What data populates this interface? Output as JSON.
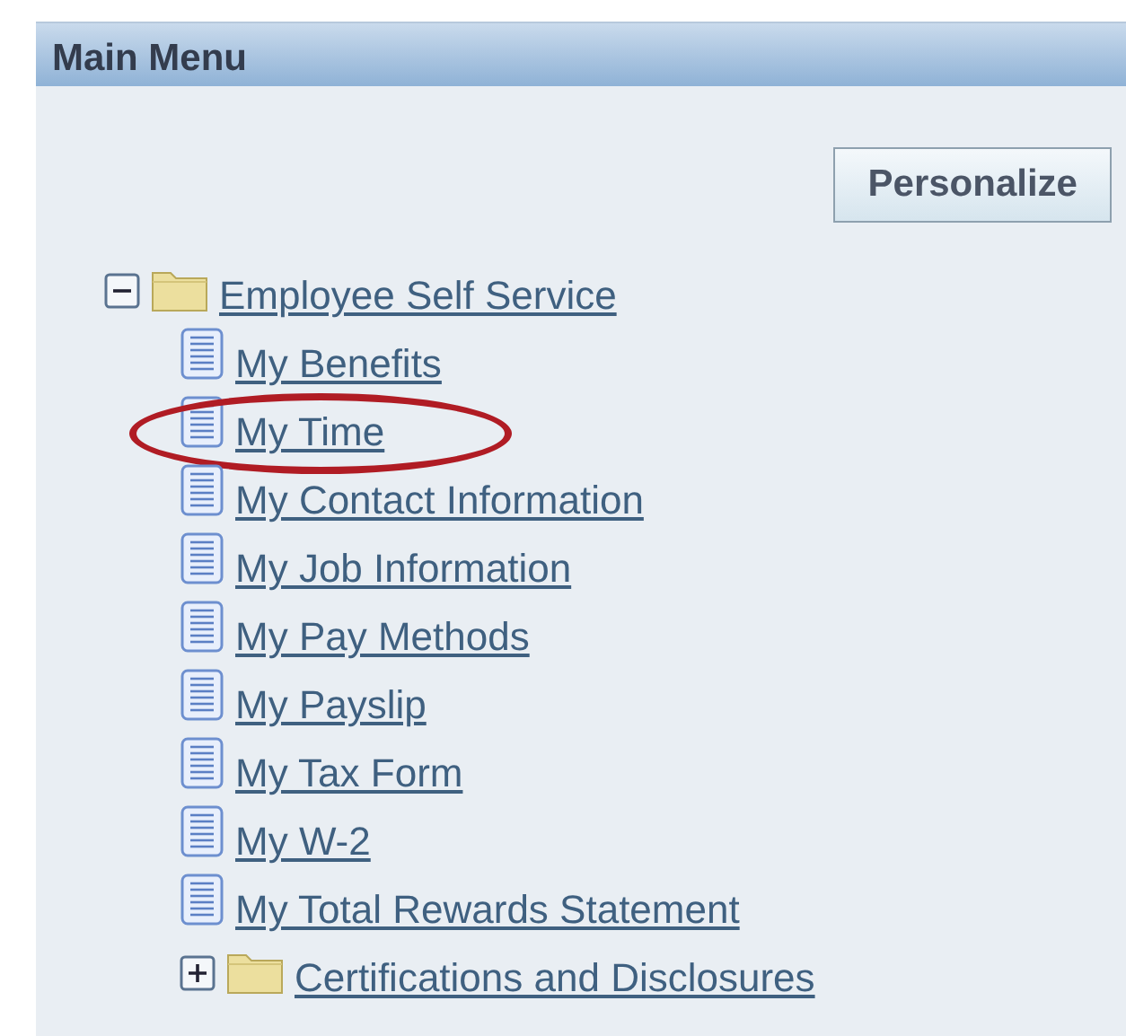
{
  "panel": {
    "title": "Main Menu"
  },
  "personalize_button": "Personalize",
  "tree": [
    {
      "kind": "folder",
      "label": "Employee Self Service",
      "expanded": true,
      "children": [
        {
          "kind": "page",
          "label": "My Benefits",
          "circled": false
        },
        {
          "kind": "page",
          "label": "My Time",
          "circled": true
        },
        {
          "kind": "page",
          "label": "My Contact Information",
          "circled": false
        },
        {
          "kind": "page",
          "label": "My Job Information",
          "circled": false
        },
        {
          "kind": "page",
          "label": "My Pay Methods",
          "circled": false
        },
        {
          "kind": "page",
          "label": "My Payslip",
          "circled": false
        },
        {
          "kind": "page",
          "label": "My Tax Form",
          "circled": false
        },
        {
          "kind": "page",
          "label": "My W-2",
          "circled": false
        },
        {
          "kind": "page",
          "label": "My Total Rewards Statement",
          "circled": false
        },
        {
          "kind": "folder",
          "label": "Certifications and Disclosures",
          "expanded": false
        }
      ]
    }
  ]
}
